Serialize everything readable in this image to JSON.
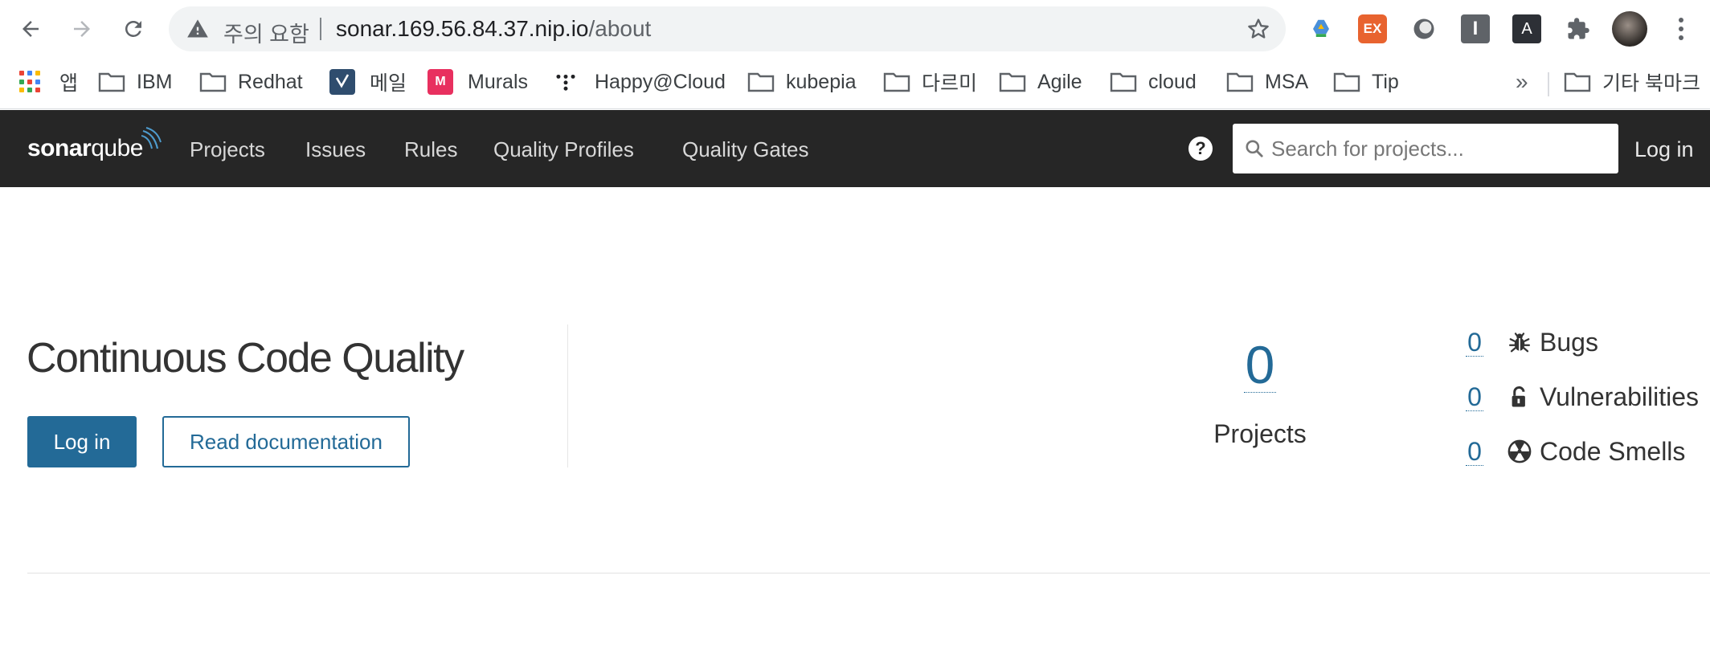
{
  "browser": {
    "security_warning": "주의 요함",
    "url_host": "sonar.169.56.84.37.nip.io",
    "url_path": "/about",
    "extensions": [
      {
        "name": "ex",
        "label": "EX"
      },
      {
        "name": "instapaper",
        "label": "I"
      },
      {
        "name": "a-ext",
        "label": "A"
      }
    ],
    "bookmarks": [
      {
        "label": "앱",
        "icon": "apps-grid-icon"
      },
      {
        "label": "IBM",
        "icon": "folder-icon"
      },
      {
        "label": "Redhat",
        "icon": "folder-icon"
      },
      {
        "label": "메일",
        "icon": "mail-app-icon"
      },
      {
        "label": "Murals",
        "icon": "mural-icon"
      },
      {
        "label": "Happy@Cloud",
        "icon": "dots-icon"
      },
      {
        "label": "kubepia",
        "icon": "folder-icon"
      },
      {
        "label": "다르미",
        "icon": "folder-icon"
      },
      {
        "label": "Agile",
        "icon": "folder-icon"
      },
      {
        "label": "cloud",
        "icon": "folder-icon"
      },
      {
        "label": "MSA",
        "icon": "folder-icon"
      },
      {
        "label": "Tip",
        "icon": "folder-icon"
      }
    ],
    "bookmarks_more": "»",
    "other_bookmarks": "기타 북마크",
    "mural_badge": "M"
  },
  "sonarqube": {
    "logo_light": "sonar",
    "logo_bold": "qube",
    "nav": [
      "Projects",
      "Issues",
      "Rules",
      "Quality Profiles",
      "Quality Gates"
    ],
    "help": "?",
    "search_placeholder": "Search for projects...",
    "login_link": "Log in"
  },
  "about": {
    "headline": "Continuous Code Quality",
    "login_button": "Log in",
    "docs_button": "Read documentation",
    "projects_count": "0",
    "projects_label": "Projects",
    "metrics": [
      {
        "value": "0",
        "label": "Bugs",
        "icon": "bug-icon"
      },
      {
        "value": "0",
        "label": "Vulnerabilities",
        "icon": "lock-open-icon"
      },
      {
        "value": "0",
        "label": "Code Smells",
        "icon": "radiation-icon"
      }
    ]
  },
  "colors": {
    "brand_blue": "#236a97",
    "navbar_bg": "#262626"
  }
}
